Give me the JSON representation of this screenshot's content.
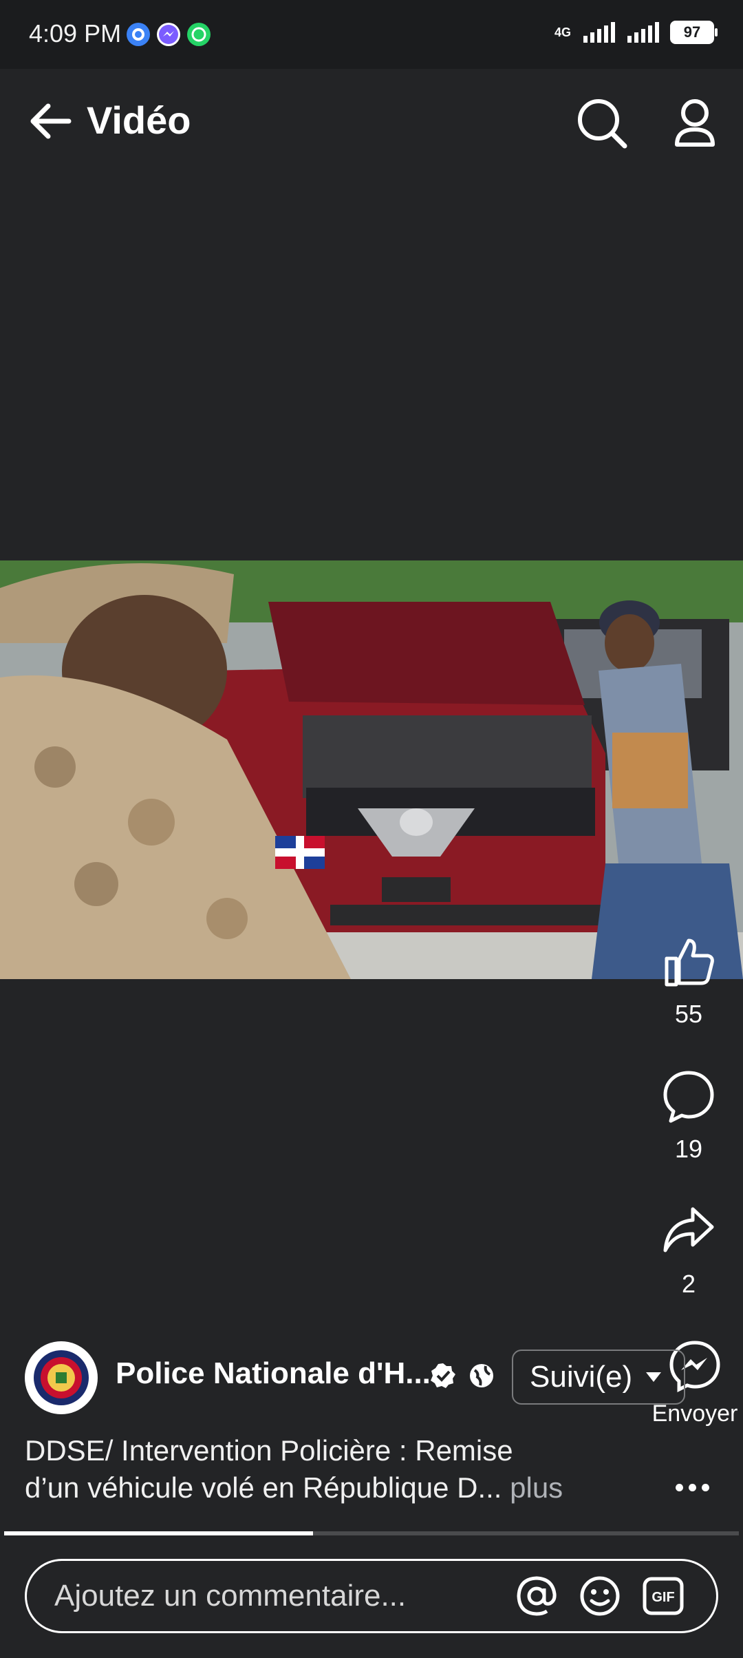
{
  "status_bar": {
    "time": "4:09 PM",
    "network": "4G",
    "battery": "97",
    "app_icons": [
      "settings-icon",
      "messenger-icon",
      "whatsapp-icon"
    ]
  },
  "header": {
    "title": "Vidéo",
    "icons": [
      "back-arrow-icon",
      "search-icon",
      "profile-icon"
    ]
  },
  "actions": {
    "like_count": "55",
    "comment_count": "19",
    "share_count": "2",
    "send_label": "Envoyer"
  },
  "post": {
    "author": "Police Nationale d'H...",
    "follow_label": "Suivi(e)",
    "caption_line1": "DDSE/ Intervention Policière : Remise",
    "caption_line2": "d’un véhicule volé en République D...",
    "more_label": "plus"
  },
  "video": {
    "progress": 0.42
  },
  "comment": {
    "placeholder": "Ajoutez un commentaire..."
  },
  "colors": {
    "background": "#232426",
    "status_bar": "#1b1c1e",
    "text": "#ffffff",
    "muted": "#b0b3b8"
  }
}
